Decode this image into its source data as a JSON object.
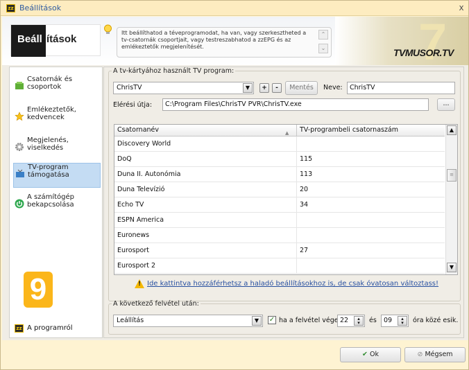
{
  "window": {
    "title": "Beállítások",
    "close": "x"
  },
  "header": {
    "title_dark": "Beáll",
    "title_light": "ítások",
    "info_text": "Itt beállíthatod a téveprogramodat, ha van, vagy szerkesztheted a tv-csatornák csoportjait, vagy testreszabhatod a zzEPG és az emlékeztetők megjelenítését.",
    "brand": "TVMUSOR.TV",
    "brand_digit": "7"
  },
  "sidebar": {
    "items": [
      {
        "label": "Csatornák és csoportok",
        "icon": "tv-channels-icon"
      },
      {
        "label": "Emlékeztetők, kedvencek",
        "icon": "star-icon"
      },
      {
        "label": "Megjelenés, viselkedés",
        "icon": "gear-icon"
      },
      {
        "label": "TV-program támogatása",
        "icon": "tv-card-icon"
      },
      {
        "label": "A számítógép bekapcsolása",
        "icon": "power-icon"
      }
    ],
    "badge": "9",
    "about": "A programról"
  },
  "tv_group": {
    "legend": "A tv-kártyához használt TV program:",
    "program_value": "ChrisTV",
    "add": "+",
    "remove": "-",
    "save": "Mentés",
    "name_label": "Neve:",
    "name_value": "ChrisTV",
    "path_label": "Elérési útja:",
    "path_value": "C:\\Program Files\\ChrisTV PVR\\ChrisTV.exe",
    "browse": "...",
    "columns": [
      "Csatornanév",
      "TV-programbeli csatornaszám"
    ],
    "rows": [
      {
        "name": "Discovery World",
        "number": ""
      },
      {
        "name": "DoQ",
        "number": "115"
      },
      {
        "name": "Duna II. Autonómia",
        "number": "113"
      },
      {
        "name": "Duna Televízió",
        "number": "20"
      },
      {
        "name": "Echo TV",
        "number": "34"
      },
      {
        "name": "ESPN America",
        "number": ""
      },
      {
        "name": "Euronews",
        "number": ""
      },
      {
        "name": "Eurosport",
        "number": "27"
      },
      {
        "name": "Eurosport 2",
        "number": ""
      }
    ],
    "warning": "Ide kattintva hozzáférhetsz a haladó beállításokhoz is, de csak óvatosan változtass!"
  },
  "after_group": {
    "legend": "A következő felvétel után:",
    "action_value": "Leállítás",
    "checkbox_checked": true,
    "checkbox_label": "ha a felvétel vége",
    "hour": "22",
    "and": "és",
    "minute": "09",
    "suffix": "óra közé esik."
  },
  "buttons": {
    "ok": "Ok",
    "cancel": "Mégsem"
  }
}
